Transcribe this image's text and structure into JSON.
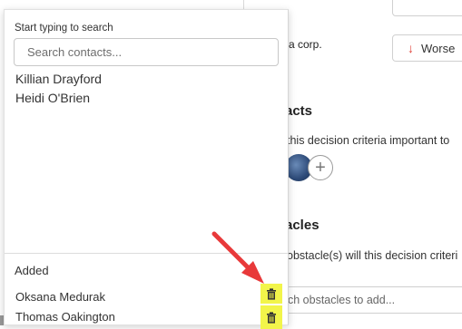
{
  "background": {
    "company_text": "a corp.",
    "worse_button": {
      "arrow": "↓",
      "label": "Worse"
    },
    "contacts_heading": "acts",
    "contacts_question": "this decision criteria important to",
    "add_contact_symbol": "+",
    "obstacles_heading": "acles",
    "obstacles_question": "obstacle(s) will this decision criteri",
    "obstacles_placeholder": "ch obstacles to add..."
  },
  "search_panel": {
    "label": "Start typing to search",
    "placeholder": "Search contacts...",
    "results": [
      "Killian Drayford",
      "Heidi O'Brien"
    ],
    "added_heading": "Added",
    "added": [
      "Oksana Medurak",
      "Thomas Oakington"
    ]
  },
  "colors": {
    "annotation_arrow": "#e8393a",
    "highlight": "#f2f54a",
    "worse_arrow": "#e0433a"
  }
}
